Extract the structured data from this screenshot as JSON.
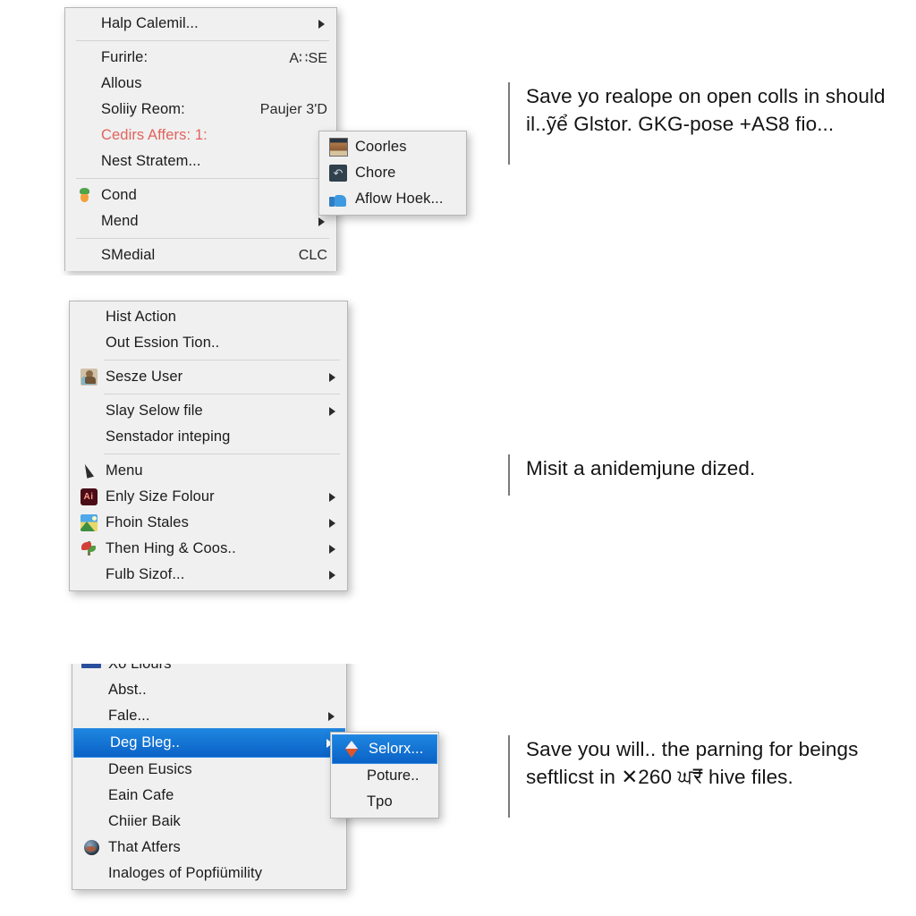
{
  "background_color": "#ffffff",
  "menu_background": "#f0f0f0",
  "highlight_color": "#0b62c6",
  "danger_text_color": "#e1635c",
  "panels": [
    {
      "name": "panel-one",
      "menu": {
        "items": [
          {
            "label": "Halp Calemil...",
            "icon": "",
            "accel": "",
            "arrow": true,
            "separator_after": true
          },
          {
            "label": "Furirle:",
            "icon": "",
            "accel": "A∷SE",
            "arrow": false
          },
          {
            "label": "Allous",
            "icon": "",
            "accel": "",
            "arrow": false
          },
          {
            "label": "Soliiy Reom:",
            "icon": "",
            "accel": "Paujer 3'D",
            "arrow": false
          },
          {
            "label": "Cedirs Affers: 1:",
            "icon": "",
            "accel": "",
            "arrow": true,
            "danger": true
          },
          {
            "label": "Nest Stratem...",
            "icon": "",
            "accel": "",
            "arrow": true,
            "separator_after": true
          },
          {
            "label": "Cond",
            "icon": "carrot-icon",
            "accel": "",
            "arrow": true
          },
          {
            "label": "Mend",
            "icon": "",
            "accel": "",
            "arrow": true,
            "separator_after": true
          },
          {
            "label": "SMedial",
            "icon": "",
            "accel": "CLC",
            "arrow": false
          }
        ]
      },
      "submenu": {
        "items": [
          {
            "label": "Coorles",
            "icon": "thumbnail-icon"
          },
          {
            "label": "Chore",
            "icon": "undo-icon"
          },
          {
            "label": "Aflow Hoek...",
            "icon": "thumbs-up-icon"
          }
        ]
      },
      "caption": "Save yo realope on open colls in should il..ỹể Glstor. GKG-pose +AS8 fio..."
    },
    {
      "name": "panel-two",
      "menu": {
        "items": [
          {
            "label": "Hist Action",
            "icon": "",
            "accel": "",
            "arrow": false
          },
          {
            "label": "Out Ession Tion..",
            "icon": "",
            "accel": "",
            "arrow": false,
            "separator_after": true
          },
          {
            "label": "Sesze User",
            "icon": "person-icon",
            "accel": "",
            "arrow": true,
            "separator_after": true
          },
          {
            "label": "Slay Selow file",
            "icon": "",
            "accel": "",
            "arrow": true
          },
          {
            "label": "Senstador inteping",
            "icon": "",
            "accel": "",
            "arrow": false,
            "separator_after": true
          },
          {
            "label": "Menu",
            "icon": "cursor-icon",
            "accel": "",
            "arrow": false
          },
          {
            "label": "Enly Size Folour",
            "icon": "ai-icon",
            "accel": "",
            "arrow": true
          },
          {
            "label": "Fhoin Stales",
            "icon": "photo-icon",
            "accel": "",
            "arrow": true
          },
          {
            "label": "Then Hing & Coos..",
            "icon": "plant-icon",
            "accel": "",
            "arrow": true
          },
          {
            "label": "Fulb Sizof...",
            "icon": "",
            "accel": "",
            "arrow": true
          }
        ]
      },
      "caption": "Misit a anidemjune dized."
    },
    {
      "name": "panel-three",
      "menu": {
        "items": [
          {
            "label": "Xo Llours",
            "icon": "blue-bar-icon",
            "accel": "",
            "arrow": false,
            "clipped": true
          },
          {
            "label": "Abst..",
            "icon": "",
            "accel": "",
            "arrow": false
          },
          {
            "label": "Fale...",
            "icon": "",
            "accel": "",
            "arrow": true
          },
          {
            "label": "Deg Bleg..",
            "icon": "",
            "accel": "",
            "arrow": true,
            "selected": true
          },
          {
            "label": "Deen Eusics",
            "icon": "",
            "accel": "",
            "arrow": false
          },
          {
            "label": "Eain Cafe",
            "icon": "",
            "accel": "",
            "arrow": false
          },
          {
            "label": "Chiier Baik",
            "icon": "",
            "accel": "",
            "arrow": false
          },
          {
            "label": "That Atfers",
            "icon": "globe-icon",
            "accel": "",
            "arrow": false
          },
          {
            "label": "Inaloges of Popfiümility",
            "icon": "",
            "accel": "",
            "arrow": false
          }
        ]
      },
      "submenu": {
        "items": [
          {
            "label": "Selorx...",
            "icon": "diamond-icon",
            "selected": true
          },
          {
            "label": "Poture..",
            "icon": ""
          },
          {
            "label": "Tpo",
            "icon": ""
          }
        ]
      },
      "caption": "Save you will.. the parning for beings seftlicst in ✕260 ਘ₹ hive files."
    }
  ]
}
